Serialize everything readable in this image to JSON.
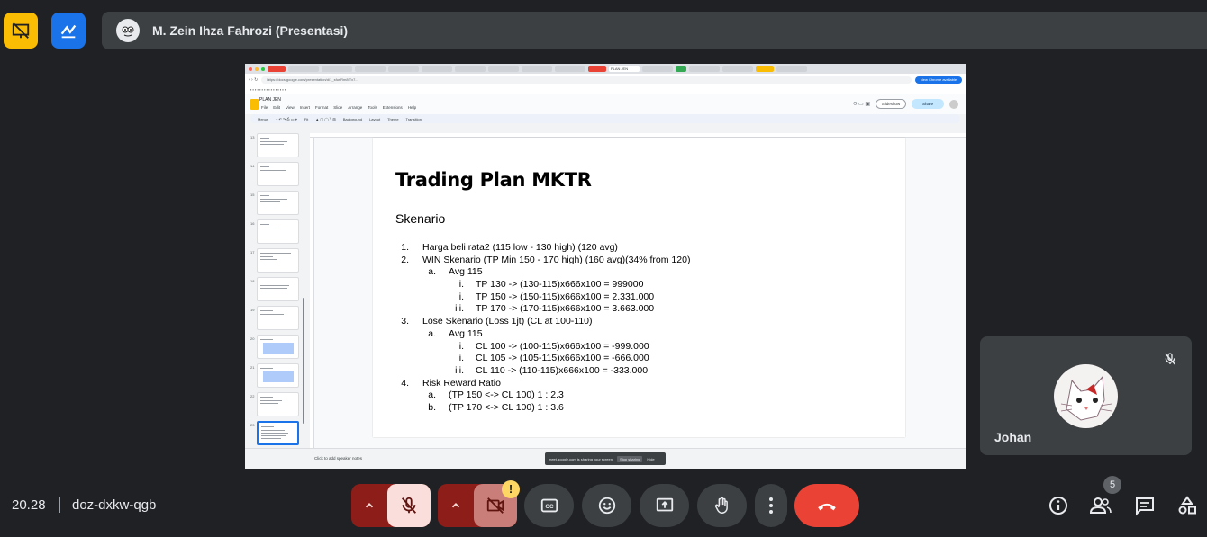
{
  "meet": {
    "presenter_name": "M. Zein Ihza Fahrozi (Presentasi)",
    "time": "20.28",
    "meeting_code": "doz-dxkw-qgb",
    "participant_count": "5",
    "tile_name": "Johan",
    "warning_symbol": "!"
  },
  "shared_screen": {
    "url": "https://docs.google.com/presentation/d/1_sfuriRm8fTx7...",
    "update_button": "New Chrome available",
    "doc_title": "PLAN JEN",
    "menus": [
      "File",
      "Edit",
      "View",
      "Insert",
      "Format",
      "Slide",
      "Arrange",
      "Tools",
      "Extensions",
      "Help"
    ],
    "toolbar": [
      "Menus",
      "Fit",
      "Background",
      "Layout",
      "Theme",
      "Transition"
    ],
    "slideshow_label": "Slideshow",
    "share_label": "Share",
    "thumb_numbers": [
      "13",
      "14",
      "15",
      "16",
      "17",
      "18",
      "19",
      "20",
      "21",
      "22",
      "23"
    ],
    "notes_placeholder": "Click to add speaker notes",
    "share_notice": "meet.google.com is sharing your screen",
    "stop_sharing": "Stop sharing",
    "hide": "Hide"
  },
  "slide": {
    "title": "Trading Plan MKTR",
    "subtitle": "Skenario",
    "lines": [
      {
        "num": "1.",
        "text": "Harga beli rata2 (115 low - 130 high) (120 avg)"
      },
      {
        "num": "2.",
        "text": "WIN Skenario (TP Min 150 - 170 high) (160 avg)(34% from 120)"
      },
      {
        "num": "a.",
        "text": "Avg 115"
      },
      {
        "num": "i.",
        "text": "TP 130 -> (130-115)x666x100 = 999000"
      },
      {
        "num": "ii.",
        "text": "TP 150 -> (150-115)x666x100 = 2.331.000"
      },
      {
        "num": "iii.",
        "text": "TP 170 -> (170-115)x666x100 = 3.663.000"
      },
      {
        "num": "3.",
        "text": "Lose Skenario (Loss 1jt) (CL at 100-110)"
      },
      {
        "num": "a.",
        "text": "Avg 115"
      },
      {
        "num": "i.",
        "text": "CL 100 -> (100-115)x666x100 = -999.000"
      },
      {
        "num": "ii.",
        "text": "CL 105 -> (105-115)x666x100 = -666.000"
      },
      {
        "num": "iii.",
        "text": "CL 110 -> (110-115)x666x100 = -333.000"
      },
      {
        "num": "4.",
        "text": "Risk Reward Ratio"
      },
      {
        "num": "a.",
        "text": "(TP 150 <-> CL 100) 1 : 2.3"
      },
      {
        "num": "b.",
        "text": "(TP 170 <-> CL 100) 1 : 3.6"
      }
    ]
  },
  "colors": {
    "background": "#202124",
    "tile": "#3c4043",
    "mic_off_bg": "#f9dedc",
    "mic_off_group": "#8c1d18",
    "end_call": "#ea4335",
    "accent_yellow": "#fbbc04",
    "accent_blue": "#1a73e8"
  },
  "icons": {
    "top_left": [
      "presentation-off-icon",
      "whiteboard-icon"
    ],
    "controls": [
      "chevron-up-icon",
      "mic-off-icon",
      "chevron-up-icon",
      "camera-off-icon",
      "captions-icon",
      "emoji-icon",
      "present-icon",
      "raise-hand-icon",
      "more-vert-icon",
      "end-call-icon"
    ],
    "right": [
      "info-icon",
      "people-icon",
      "chat-icon",
      "activities-icon"
    ]
  }
}
